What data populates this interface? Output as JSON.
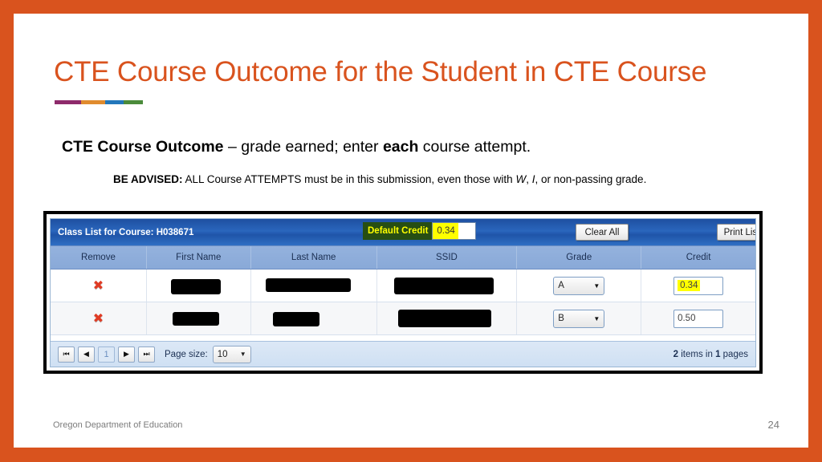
{
  "theme": {
    "border_color": "#D9531E",
    "title_color": "#D9531E",
    "rule_colors": [
      "#8E2A6B",
      "#E08B2E",
      "#2277BB",
      "#4B8B3B"
    ],
    "bar_blue": "#2a66bd",
    "highlight_yellow": "#FFFF00",
    "highlight_green": "#274E13",
    "remove_icon_red": "#E03B24"
  },
  "slide": {
    "title": "CTE Course Outcome for the Student in CTE Course",
    "lead": {
      "bold_lead": "CTE Course Outcome",
      "mid": " – grade earned; enter ",
      "bold_each": "each",
      "tail": " course attempt."
    },
    "advised": {
      "label": "BE ADVISED:",
      "part1": " ALL Course ATTEMPTS must be in this submission, even those with ",
      "italic_w": "W",
      "comma1": ", ",
      "italic_i": "I",
      "part2": ", or non-passing grade."
    },
    "footer": {
      "organization": "Oregon Department of Education",
      "page_number": "24"
    }
  },
  "widget": {
    "titlebar": {
      "class_list_label": "Class List for Course: H038671",
      "default_credit_label": "Default Credit",
      "default_credit_value": "0.34",
      "clear_all_label": "Clear All",
      "print_list_label": "Print List"
    },
    "columns": [
      {
        "key": "remove",
        "label": "Remove"
      },
      {
        "key": "first_name",
        "label": "First Name"
      },
      {
        "key": "last_name",
        "label": "Last Name"
      },
      {
        "key": "ssid",
        "label": "SSID"
      },
      {
        "key": "grade",
        "label": "Grade"
      },
      {
        "key": "credit",
        "label": "Credit"
      }
    ],
    "rows": [
      {
        "remove_icon": "remove-x-icon",
        "first_name": "",
        "last_name": "",
        "ssid": "",
        "grade": "A",
        "credit": "0.34",
        "credit_highlighted": true
      },
      {
        "remove_icon": "remove-x-icon",
        "first_name": "",
        "last_name": "",
        "ssid": "",
        "grade": "B",
        "credit": "0.50",
        "credit_highlighted": false
      }
    ],
    "pager": {
      "first_glyph": "⏮",
      "prev_glyph": "◀",
      "current_page": "1",
      "next_glyph": "▶",
      "last_glyph": "⏭",
      "page_size_label": "Page size:",
      "page_size_value": "10",
      "arrow_glyph": "▼",
      "items_count": "2",
      "items_word": " items in ",
      "pages_count": "1",
      "pages_word": " pages"
    }
  }
}
